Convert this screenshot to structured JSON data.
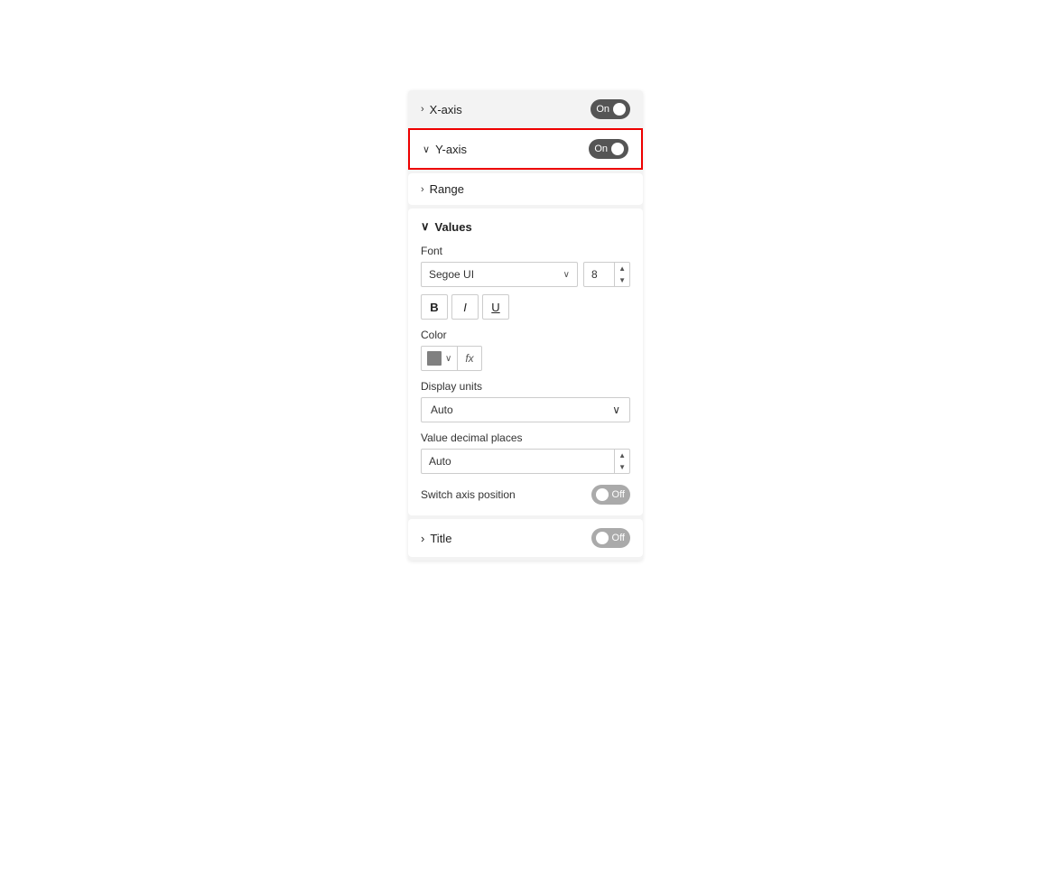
{
  "xaxis": {
    "label": "X-axis",
    "toggle_label": "On",
    "chevron": "›"
  },
  "yaxis": {
    "label": "Y-axis",
    "toggle_label": "On",
    "chevron": "∨"
  },
  "range": {
    "label": "Range",
    "chevron": "›"
  },
  "values": {
    "section_label": "Values",
    "chevron": "∨",
    "font_label": "Font",
    "font_name": "Segoe UI",
    "font_size": "8",
    "bold_label": "B",
    "italic_label": "I",
    "underline_label": "U",
    "color_label": "Color",
    "fx_label": "fx",
    "display_units_label": "Display units",
    "display_units_value": "Auto",
    "decimal_label": "Value decimal places",
    "decimal_value": "Auto",
    "switch_axis_label": "Switch axis position",
    "switch_toggle_label": "Off"
  },
  "title": {
    "label": "Title",
    "chevron": "›",
    "toggle_label": "Off"
  }
}
